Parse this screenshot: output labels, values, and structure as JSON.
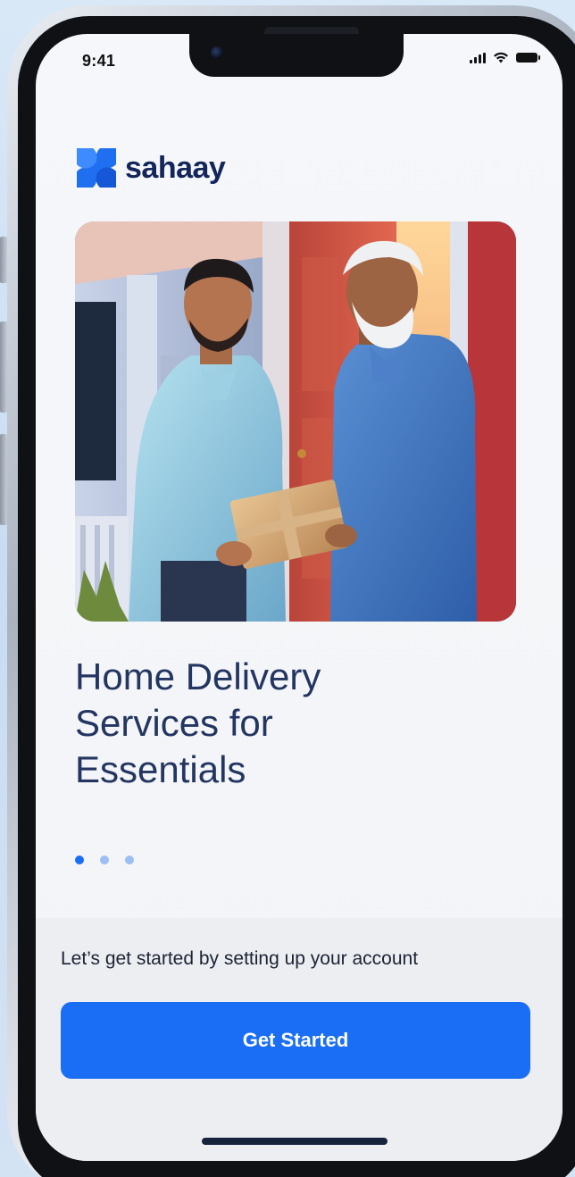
{
  "status_bar": {
    "time": "9:41"
  },
  "brand": {
    "name": "sahaay",
    "logo_icon": "sahaay-flower-logo-icon",
    "color": "#13255a",
    "logo_color": "#1f6ff0"
  },
  "onboarding": {
    "slide_title_line1": "Home Delivery",
    "slide_title_line2": "Services for",
    "slide_title_line3": "Essentials",
    "page_indicator": {
      "total": 3,
      "active_index": 0
    },
    "hero_image_icon": "delivery-illustration"
  },
  "footer": {
    "subtitle": "Let’s get started by setting up your account",
    "cta_label": "Get Started"
  },
  "colors": {
    "accent": "#1a6ef5",
    "dot_active": "#1a6ef5",
    "dot_inactive": "#9cbef2",
    "headline": "#233560"
  }
}
